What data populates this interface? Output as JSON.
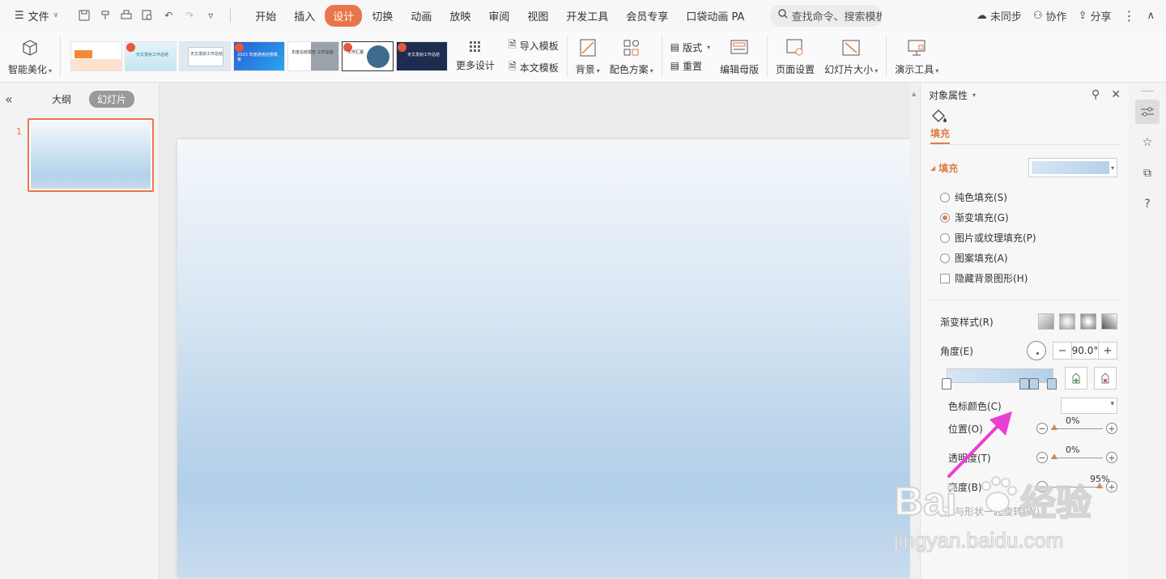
{
  "menubar": {
    "file_label": "文件",
    "tabs": [
      {
        "label": "开始"
      },
      {
        "label": "插入"
      },
      {
        "label": "设计"
      },
      {
        "label": "切换"
      },
      {
        "label": "动画"
      },
      {
        "label": "放映"
      },
      {
        "label": "审阅"
      },
      {
        "label": "视图"
      },
      {
        "label": "开发工具"
      },
      {
        "label": "会员专享"
      },
      {
        "label": "口袋动画 PA"
      }
    ],
    "active_tab": "设计",
    "search_placeholder": "查找命令、搜索模板",
    "right": {
      "sync": "未同步",
      "collab": "协作",
      "share": "分享"
    }
  },
  "ribbon": {
    "beautify_label": "智能美化",
    "templates": [
      {
        "title": ""
      },
      {
        "title": "天文发射工作总结"
      },
      {
        "title": "天文发射工作总结"
      },
      {
        "title": "202X 年度通用创意模板"
      },
      {
        "title": "年度总结报告 工作总结"
      },
      {
        "title": "工作汇报"
      },
      {
        "title": "天文发射工作总结"
      }
    ],
    "more_design": "更多设计",
    "import_template": "导入模板",
    "this_template": "本文模板",
    "background": "背景",
    "color_scheme": "配色方案",
    "layout": "版式",
    "reset": "重置",
    "edit_master": "编辑母版",
    "page_setup": "页面设置",
    "slide_size": "幻灯片大小",
    "presentation_tools": "演示工具"
  },
  "left_panel": {
    "outline_tab": "大纲",
    "slides_tab": "幻灯片",
    "slides": [
      {
        "number": "1"
      }
    ]
  },
  "properties": {
    "title": "对象属性",
    "tab_fill": "填充",
    "section_label": "填充",
    "fill_options": [
      {
        "label": "纯色填充(S)",
        "selected": false
      },
      {
        "label": "渐变填充(G)",
        "selected": true
      },
      {
        "label": "图片或纹理填充(P)",
        "selected": false
      },
      {
        "label": "图案填充(A)",
        "selected": false
      }
    ],
    "hide_bg_graphics": "隐藏背景图形(H)",
    "gradient_style_label": "渐变样式(R)",
    "angle_label": "角度(E)",
    "angle_value": "90.0°",
    "stop_color_label": "色标颜色(C)",
    "position_label": "位置(O)",
    "position_value": "0%",
    "transparency_label": "透明度(T)",
    "transparency_value": "0%",
    "brightness_label": "亮度(B)",
    "brightness_value": "95%",
    "rotate_with_shape": "与形状一起旋转(W)"
  },
  "colors": {
    "accent": "#e9764a",
    "annotation_arrow": "#e93fd6"
  },
  "watermark": {
    "brand": "Baidu经验",
    "url": "jingyan.baidu.com"
  }
}
